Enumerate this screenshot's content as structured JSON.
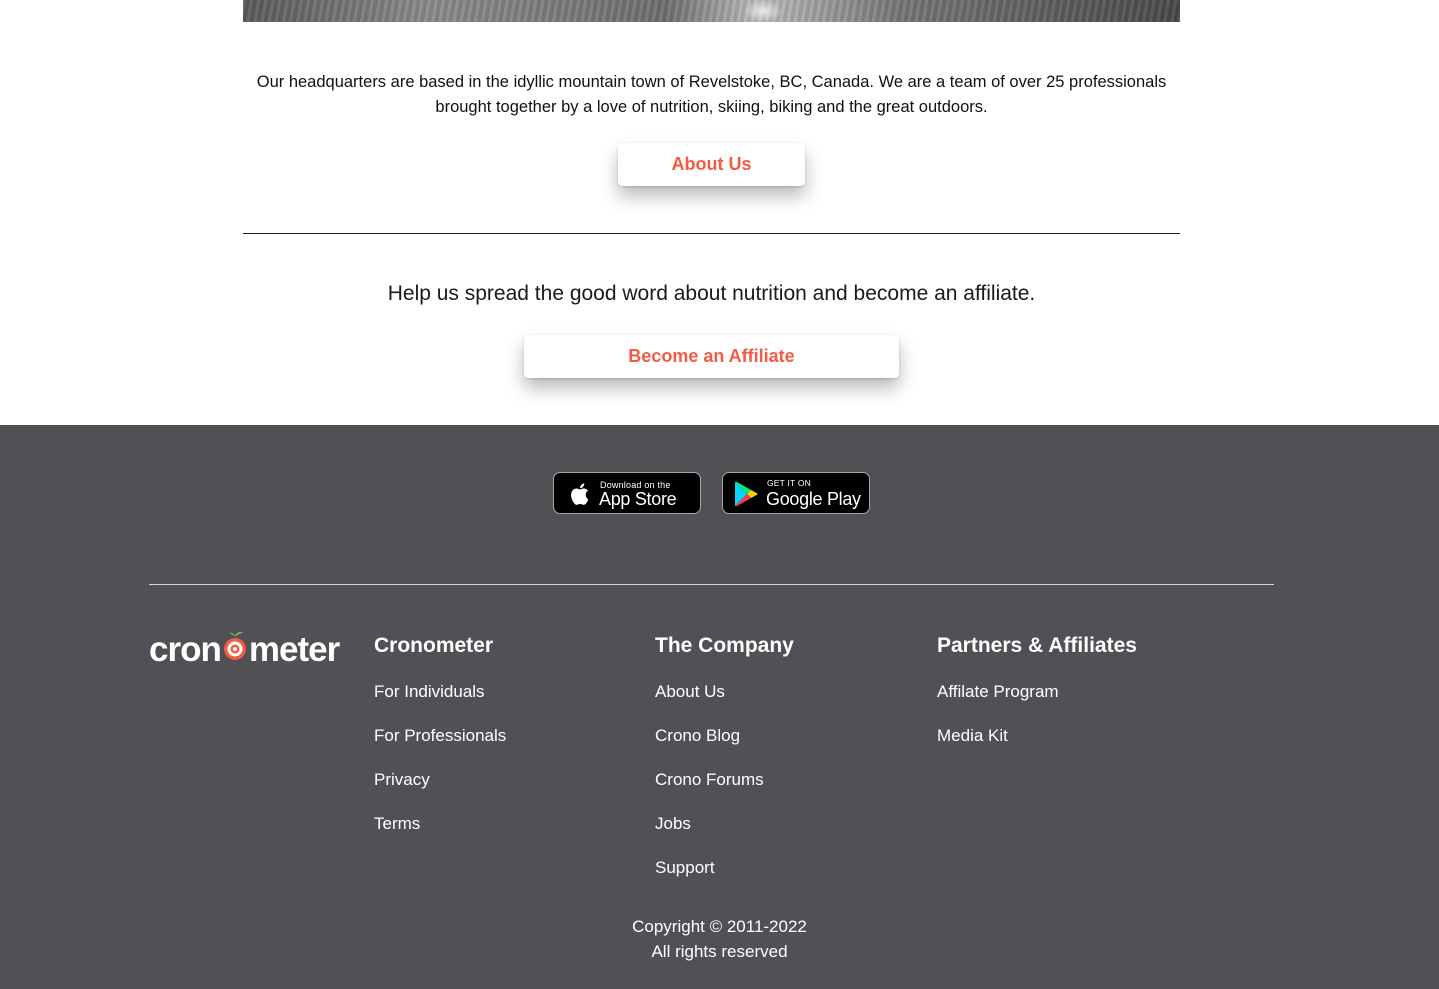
{
  "about_section": {
    "description": "Our headquarters are based in the idyllic mountain town of Revelstoke, BC, Canada. We are a team of over 25 professionals brought together by a love of nutrition, skiing, biking and the great outdoors.",
    "button_label": "About Us"
  },
  "affiliate_section": {
    "text": "Help us spread the good word about nutrition and become an affiliate.",
    "button_label": "Become an Affiliate"
  },
  "colors": {
    "accent": "#f25c45",
    "footer_bg": "#515055"
  },
  "footer": {
    "app_store": {
      "small": "Download on the",
      "big": "App Store",
      "icon": "apple-icon"
    },
    "google_play": {
      "small": "GET IT ON",
      "big": "Google Play",
      "icon": "google-play-icon"
    },
    "logo_text": {
      "left": "cron",
      "right": "meter"
    },
    "columns": [
      {
        "title": "Cronometer",
        "links": [
          "For Individuals",
          "For Professionals",
          "Privacy",
          "Terms"
        ]
      },
      {
        "title": "The Company",
        "links": [
          "About Us",
          "Crono Blog",
          "Crono Forums",
          "Jobs",
          "Support"
        ]
      },
      {
        "title": "Partners & Affiliates",
        "links": [
          "Affilate Program",
          "Media Kit"
        ]
      }
    ],
    "copyright_line1": "Copyright © 2011-2022",
    "copyright_line2": "All rights reserved"
  }
}
